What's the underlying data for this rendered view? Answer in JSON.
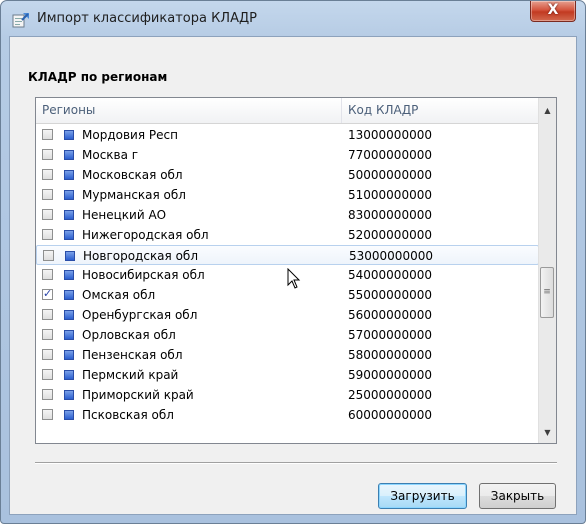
{
  "window": {
    "title": "Импорт классификатора КЛАДР",
    "close_glyph": "X"
  },
  "section": {
    "title": "КЛАДР по регионам"
  },
  "table": {
    "columns": [
      "Регионы",
      "Код КЛАДР"
    ],
    "rows": [
      {
        "name": "Мордовия Респ",
        "code": "13000000000",
        "checked": false
      },
      {
        "name": "Москва г",
        "code": "77000000000",
        "checked": false
      },
      {
        "name": "Московская обл",
        "code": "50000000000",
        "checked": false
      },
      {
        "name": "Мурманская обл",
        "code": "51000000000",
        "checked": false
      },
      {
        "name": "Ненецкий АО",
        "code": "83000000000",
        "checked": false
      },
      {
        "name": "Нижегородская обл",
        "code": "52000000000",
        "checked": false
      },
      {
        "name": "Новгородская обл",
        "code": "53000000000",
        "checked": false,
        "hovered": true
      },
      {
        "name": "Новосибирская обл",
        "code": "54000000000",
        "checked": false
      },
      {
        "name": "Омская обл",
        "code": "55000000000",
        "checked": true
      },
      {
        "name": "Оренбургская обл",
        "code": "56000000000",
        "checked": false
      },
      {
        "name": "Орловская обл",
        "code": "57000000000",
        "checked": false
      },
      {
        "name": "Пензенская обл",
        "code": "58000000000",
        "checked": false
      },
      {
        "name": "Пермский край",
        "code": "59000000000",
        "checked": false
      },
      {
        "name": "Приморский край",
        "code": "25000000000",
        "checked": false
      },
      {
        "name": "Псковская обл",
        "code": "60000000000",
        "checked": false
      }
    ],
    "scrollbar": {
      "grip_glyph": "≡",
      "up_glyph": "▲",
      "down_glyph": "▼"
    }
  },
  "buttons": {
    "load": "Загрузить",
    "close": "Закрыть"
  },
  "icons": {
    "app": "import-app-icon",
    "region": "blue-square-icon",
    "cursor": "arrow-cursor-icon"
  },
  "colors": {
    "accent": "#3c7fb1",
    "region_square": "#2c5fcf",
    "check": "#2a44a8"
  }
}
